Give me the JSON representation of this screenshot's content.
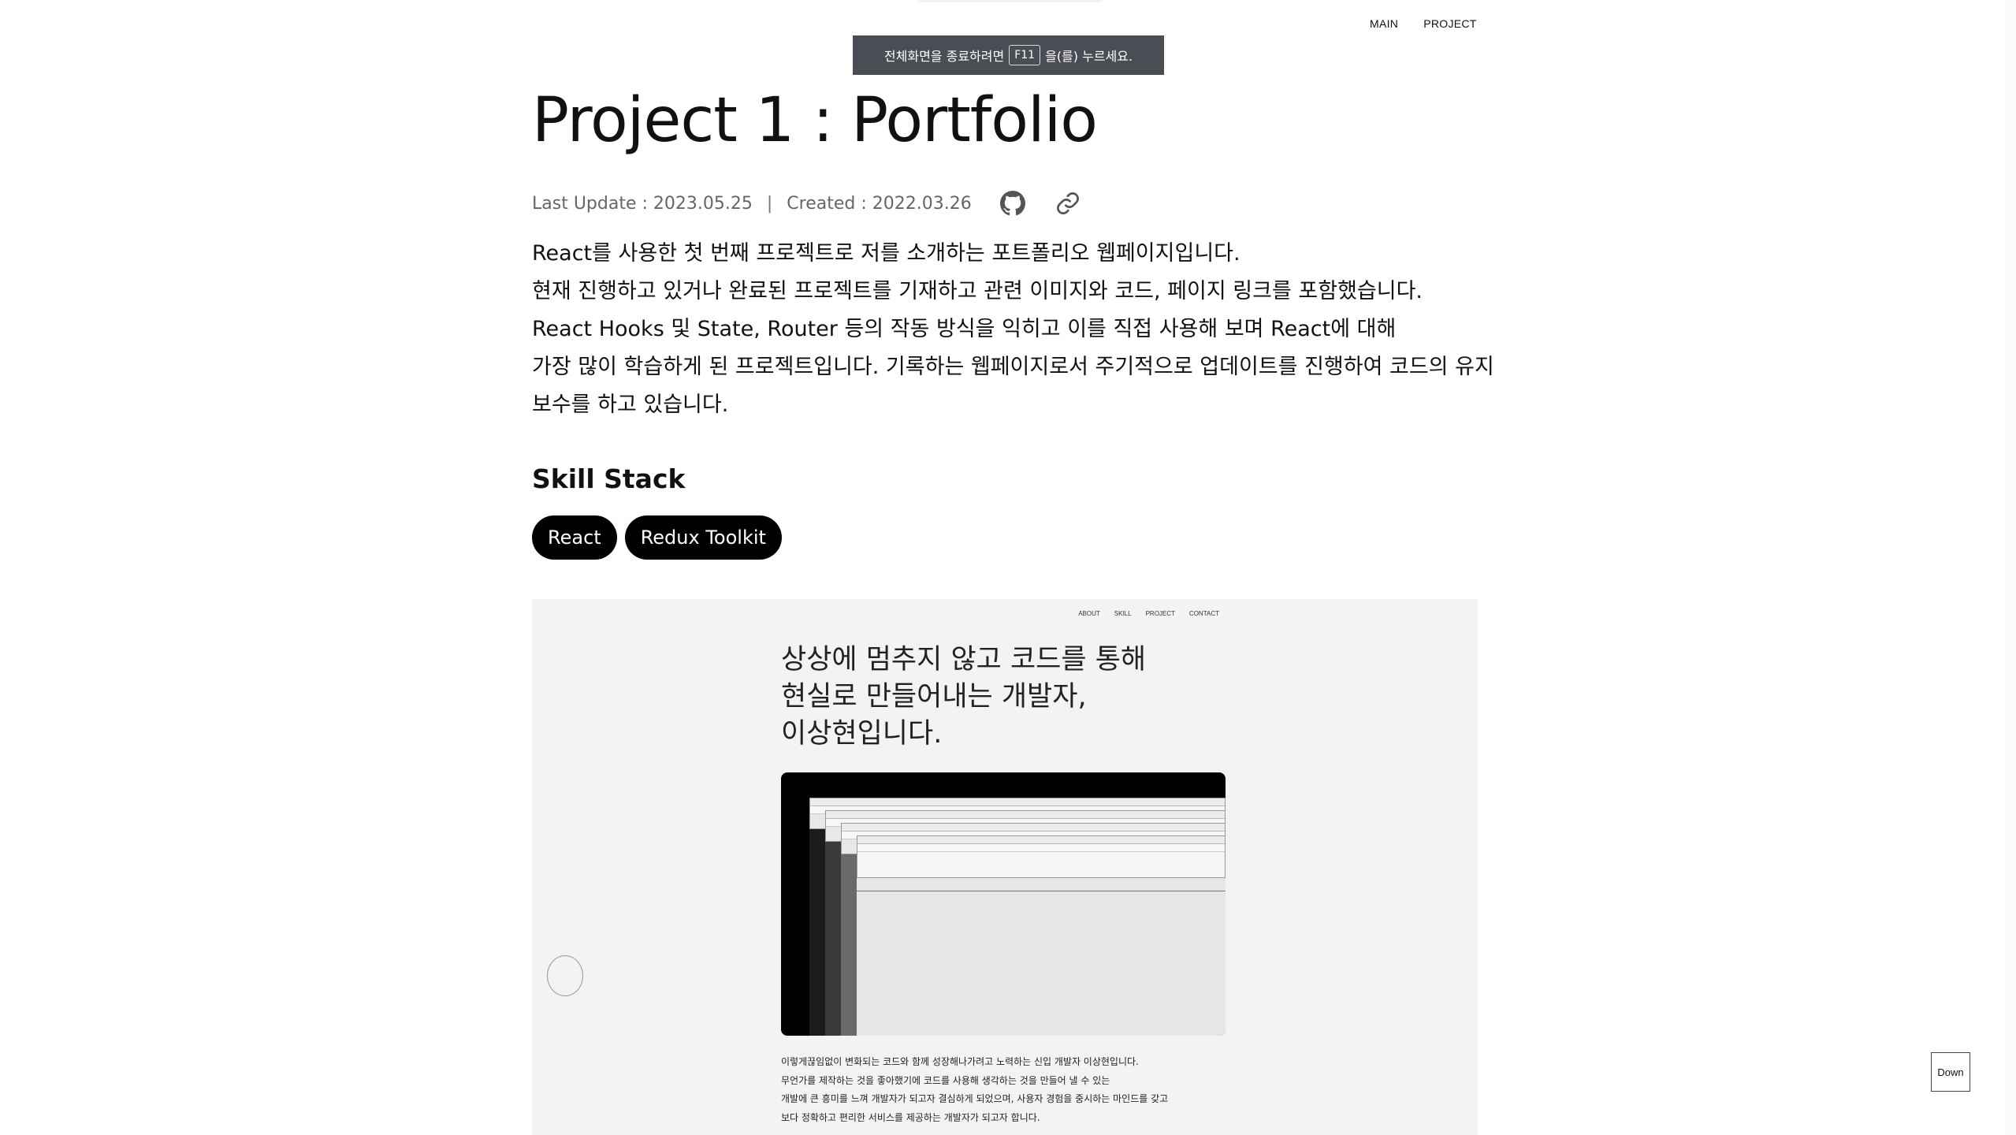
{
  "nav": {
    "items": [
      {
        "label": "MAIN"
      },
      {
        "label": "PROJECT"
      }
    ]
  },
  "toast": {
    "prefix": "전체화면을 종료하려면",
    "key": "F11",
    "suffix": "을(를) 누르세요."
  },
  "project": {
    "title": "Project 1 : Portfolio",
    "last_update": "Last Update : 2023.05.25",
    "separator": "|",
    "created": "Created : 2022.03.26",
    "icons": {
      "github": "github-icon",
      "link": "link-icon"
    },
    "description": [
      "React를 사용한 첫 번째 프로젝트로 저를 소개하는 포트폴리오 웹페이지입니다.",
      "현재 진행하고 있거나 완료된 프로젝트를 기재하고 관련 이미지와 코드, 페이지 링크를 포함했습니다.",
      "React Hooks 및 State, Router 등의 작동 방식을 익히고 이를 직접 사용해 보며 React에 대해",
      "가장 많이 학습하게 된 프로젝트입니다. 기록하는 웹페이지로서 주기적으로 업데이트를 진행하여 코드의 유지",
      "보수를 하고 있습니다."
    ],
    "skill_title": "Skill Stack",
    "skills": [
      "React",
      "Redux Toolkit"
    ]
  },
  "preview": {
    "nav": [
      "ABOUT",
      "SKILL",
      "PROJECT",
      "CONTACT"
    ],
    "headline": [
      "상상에 멈추지 않고 코드를 통해",
      "현실로 만들어내는 개발자,",
      "이상현입니다."
    ],
    "paragraph": [
      "이렇게끊임없이 변화되는 코드와 함께 성장해나가려고 노력하는 신입 개발자 이상현입니다.",
      "무언가를 제작하는 것을 좋아했기에 코드를 사용해 생각하는 것을 만들어 낼 수 있는",
      "개발에 큰 흥미를 느껴 개발자가 되고자 결심하게 되었으며, 사용자 경험을 중시하는 마인드를 갖고",
      "보다 정확하고 편리한 서비스를 제공하는 개발자가 되고자 합니다."
    ]
  },
  "down_button": {
    "label": "Down"
  }
}
